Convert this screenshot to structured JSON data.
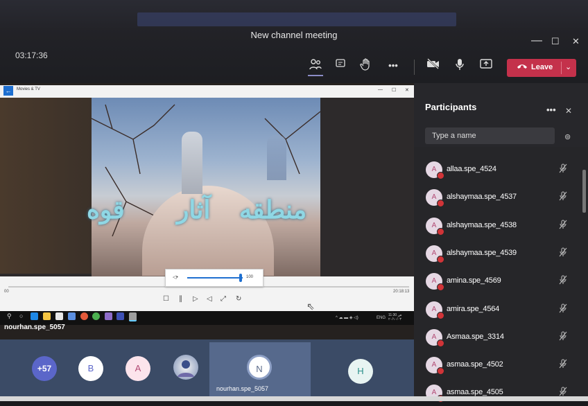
{
  "window": {
    "title": "New channel meeting",
    "minimize": "—",
    "maximize": "☐",
    "close": "✕"
  },
  "call": {
    "timer": "03:17:36",
    "toolbar": {
      "participants_icon": "people-icon",
      "chat_icon": "chat-icon",
      "raise_hand_icon": "hand-icon",
      "more_label": "•••",
      "camera_icon": "camera-off-icon",
      "mic_icon": "mic-icon",
      "share_icon": "share-icon",
      "leave_label": "Leave"
    }
  },
  "shared_screen": {
    "app_title": "Movies & TV",
    "video_text_1": "منطقه",
    "video_text_2": "آثار",
    "video_text_3": "قوه",
    "time_left": "00",
    "time_right": "20:18:13",
    "volume_min": "◁•",
    "volume_max": "100",
    "taskbar_clock": "11:30 ص\n٢٠/١٠/٠٣",
    "taskbar_lang": "ENG",
    "presenter_caption": "nourhan.spe_5057"
  },
  "gallery": {
    "more_count": "+57",
    "tiles": [
      "B",
      "A",
      "N",
      "H"
    ],
    "selected_name": "nourhan.spe_5057"
  },
  "participants_panel": {
    "title": "Participants",
    "more": "•••",
    "close": "✕",
    "search_placeholder": "Type a name",
    "people": [
      {
        "initial": "A",
        "name": "allaa.spe_4524"
      },
      {
        "initial": "A",
        "name": "alshaymaa.spe_4537"
      },
      {
        "initial": "A",
        "name": "alshaymaa.spe_4538"
      },
      {
        "initial": "A",
        "name": "alshaymaa.spe_4539"
      },
      {
        "initial": "A",
        "name": "amina.spe_4569"
      },
      {
        "initial": "A",
        "name": "amira.spe_4564"
      },
      {
        "initial": "A",
        "name": "Asmaa.spe_3314"
      },
      {
        "initial": "A",
        "name": "asmaa.spe_4502"
      },
      {
        "initial": "A",
        "name": "asmaa.spe_4505"
      }
    ]
  },
  "colors": {
    "leave": "#c4314b",
    "accent": "#5b66c9",
    "panel": "#262629"
  }
}
